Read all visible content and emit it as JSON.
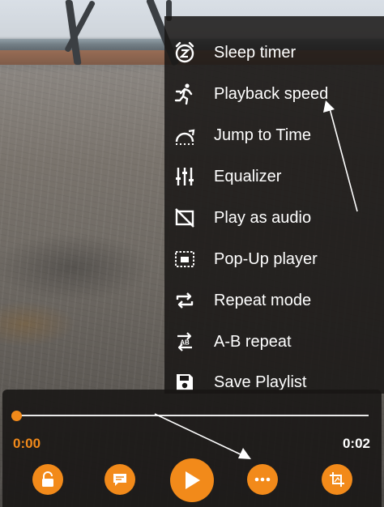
{
  "menu": {
    "items": [
      {
        "label": "Sleep timer",
        "icon": "sleep-timer-icon"
      },
      {
        "label": "Playback speed",
        "icon": "playback-speed-icon"
      },
      {
        "label": "Jump to Time",
        "icon": "jump-to-time-icon"
      },
      {
        "label": "Equalizer",
        "icon": "equalizer-icon"
      },
      {
        "label": "Play as audio",
        "icon": "play-as-audio-icon"
      },
      {
        "label": "Pop-Up player",
        "icon": "popup-player-icon"
      },
      {
        "label": "Repeat mode",
        "icon": "repeat-icon"
      },
      {
        "label": "A-B repeat",
        "icon": "ab-repeat-icon"
      },
      {
        "label": "Save Playlist",
        "icon": "save-playlist-icon"
      }
    ]
  },
  "player": {
    "elapsed": "0:00",
    "duration": "0:02",
    "progress": 0,
    "buttons": [
      "lock-icon",
      "subtitles-icon",
      "play-icon",
      "more-options-icon",
      "crop-icon"
    ]
  },
  "colors": {
    "accent": "#f28a1a",
    "menu_background": "#181615",
    "text": "#ffffff"
  }
}
